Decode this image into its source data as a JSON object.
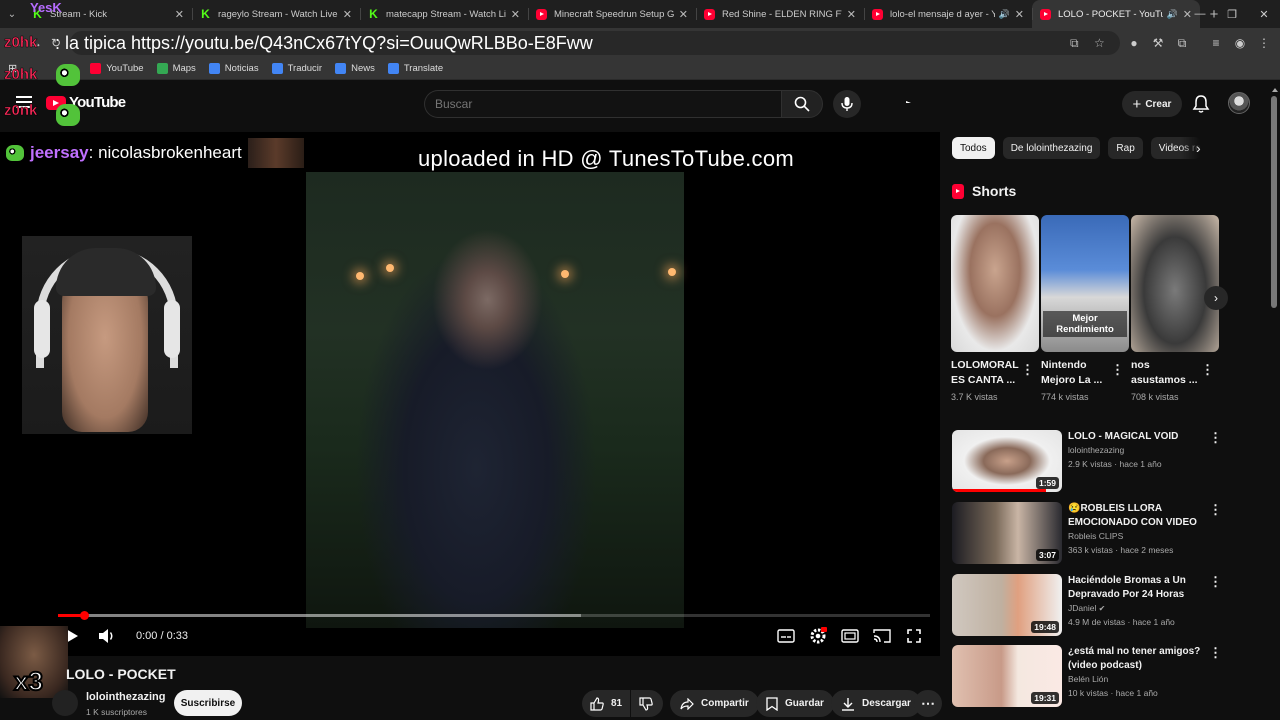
{
  "browser": {
    "tabs": [
      {
        "title": "Stream - Kick",
        "favicon": "kick",
        "active": false,
        "audio": false
      },
      {
        "title": "rageylo Stream - Watch Live on",
        "favicon": "kick",
        "active": false,
        "audio": false
      },
      {
        "title": "matecapp Stream - Watch Live",
        "favicon": "kick",
        "active": false,
        "audio": false
      },
      {
        "title": "Minecraft Speedrun Setup Guid",
        "favicon": "youtube",
        "active": false,
        "audio": false
      },
      {
        "title": "Red Shine - ELDEN RING FT ma",
        "favicon": "youtube",
        "active": false,
        "audio": false
      },
      {
        "title": "lolo-el mensaje d ayer - Yo",
        "favicon": "youtube",
        "active": false,
        "audio": true
      },
      {
        "title": "LOLO - POCKET - YouTube",
        "favicon": "youtube",
        "active": true,
        "audio": true
      }
    ],
    "new_tab": "+",
    "bookmarks": [
      {
        "label": "YouTube",
        "color": "#ff0033"
      },
      {
        "label": "Maps",
        "color": "#34a853"
      },
      {
        "label": "Noticias",
        "color": "#4285f4"
      },
      {
        "label": "Traducir",
        "color": "#4285f4"
      },
      {
        "label": "News",
        "color": "#4285f4"
      },
      {
        "label": "Translate",
        "color": "#4285f4"
      }
    ]
  },
  "overlay": {
    "yesk": "YesK",
    "chat_user_1": "z0hk",
    "chat_text_1": ": la tipica https://youtu.be/Q43nCx67tYQ?si=OuuQwRLBBo-E8Fww",
    "chat_user_2": "z0hk",
    "chat_user_3": "z0nk",
    "player_chat_user": "jeersay",
    "player_chat_msg": ": nicolasbrokenheart",
    "x3": "x3"
  },
  "youtube": {
    "logo": "YouTube",
    "search_placeholder": "Buscar",
    "create_label": "Crear",
    "player": {
      "overlay_text": "uploaded in HD @ TunesToTube.com",
      "time": "0:00 / 0:33",
      "progress_fraction": 0.03,
      "buffer_fraction": 0.6
    },
    "video": {
      "title": "LOLO - POCKET",
      "channel": "lolointhezazing",
      "subscribers": "1 K suscriptores",
      "subscribe_label": "Suscribirse",
      "likes": "81",
      "share_label": "Compartir",
      "save_label": "Guardar",
      "download_label": "Descargar"
    },
    "chips": [
      "Todos",
      "De lolointhezazing",
      "Rap",
      "Videos re"
    ],
    "shorts_heading": "Shorts",
    "shorts": [
      {
        "title": "LOLOMORAL ES CANTA ...",
        "views": "3.7 K vistas",
        "badge": ""
      },
      {
        "title": "Nintendo Mejoro La ...",
        "views": "774 k vistas",
        "badge": "Mejor Rendimiento"
      },
      {
        "title": "nos asustamos ...",
        "views": "708 k vistas",
        "badge": ""
      }
    ],
    "recommendations": [
      {
        "title": "LOLO - MAGICAL VOID",
        "channel": "lolointhezazing",
        "meta": "2.9 K vistas · hace 1 año",
        "duration": "1:59",
        "watched": 0.85,
        "verified": false
      },
      {
        "title": "😢ROBLEIS LLORA EMOCIONADO CON VIDEO DE ...",
        "channel": "Robleis CLIPS",
        "meta": "363 k vistas · hace 2 meses",
        "duration": "3:07",
        "watched": 0,
        "verified": false
      },
      {
        "title": "Haciéndole Bromas a Un Depravado Por 24 Horas",
        "channel": "JDaniel",
        "meta": "4.9 M de vistas · hace 1 año",
        "duration": "19:48",
        "watched": 0,
        "verified": true
      },
      {
        "title": "¿está mal no tener amigos? (video podcast)",
        "channel": "Belén Lión",
        "meta": "10 k vistas · hace 1 año",
        "duration": "19:31",
        "watched": 0,
        "verified": false
      }
    ]
  }
}
